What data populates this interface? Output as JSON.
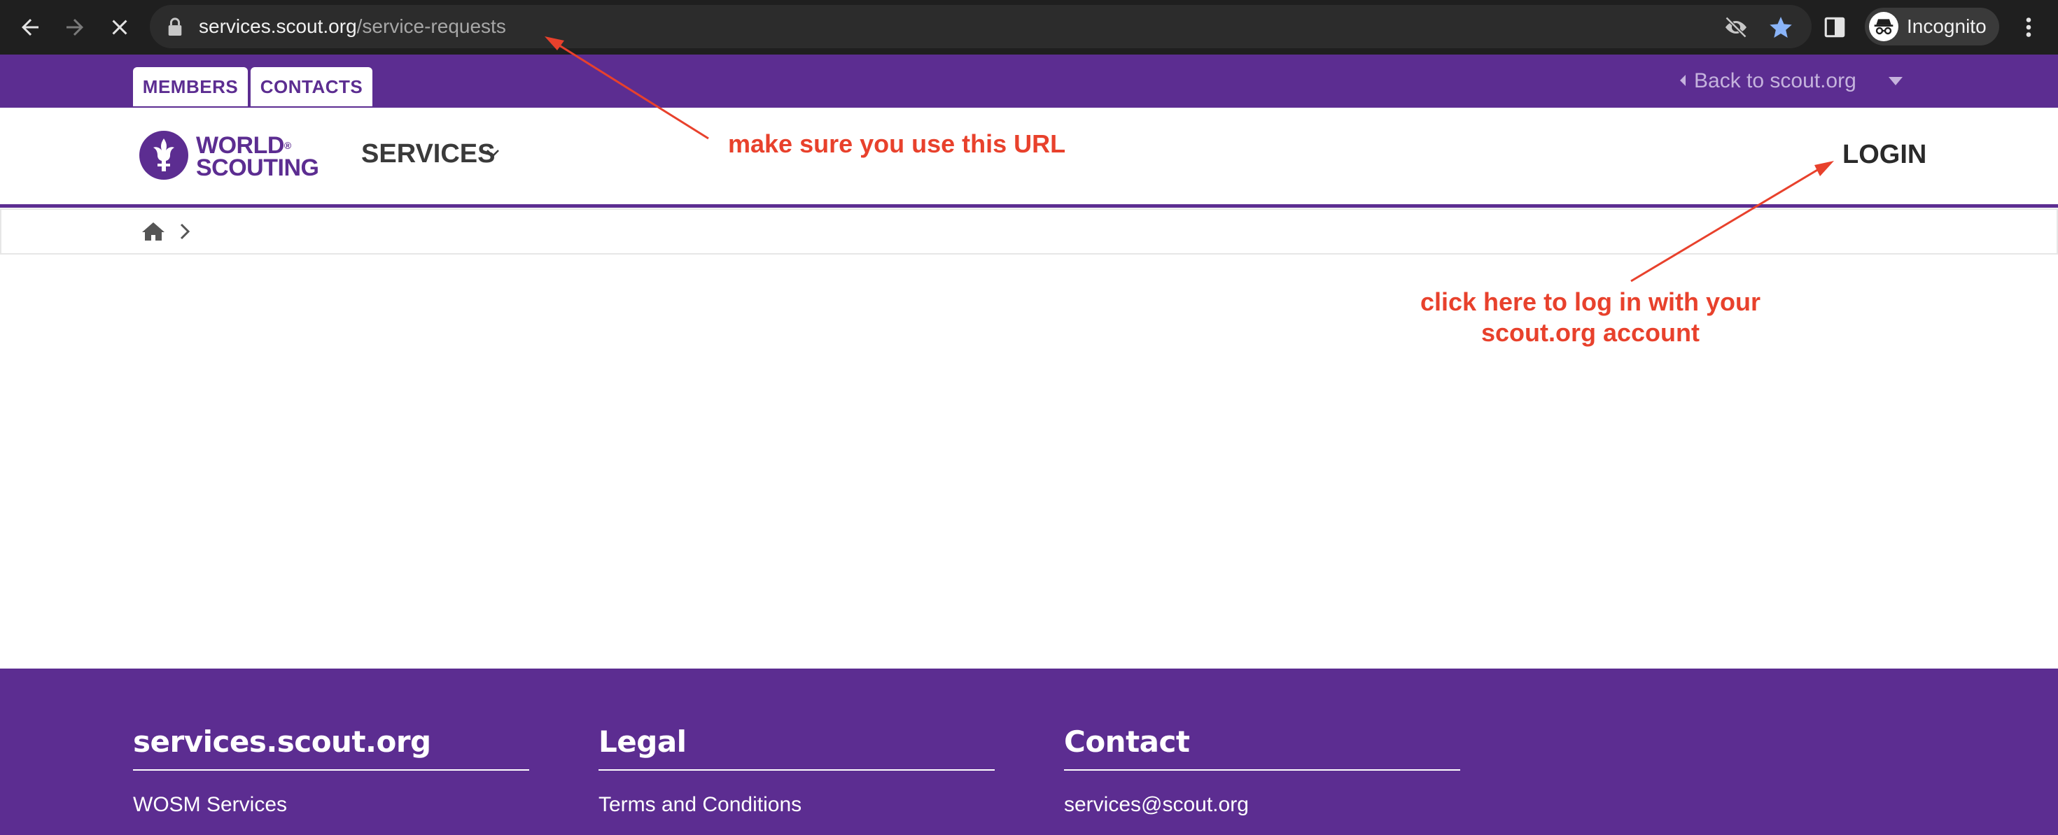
{
  "browser": {
    "url_host": "services.scout.org",
    "url_path": "/service-requests",
    "profile_label": "Incognito",
    "icons": [
      "back-arrow-icon",
      "forward-arrow-icon",
      "stop-loading-icon",
      "lock-icon",
      "eye-off-icon",
      "bookmark-star-icon",
      "side-panel-icon",
      "incognito-icon",
      "kebab-menu-icon"
    ]
  },
  "topbar": {
    "tabs": [
      "MEMBERS",
      "CONTACTS"
    ],
    "back_link": "Back to scout.org"
  },
  "header": {
    "logo_line1": "WORLD",
    "logo_line2": "SCOUTING",
    "logo_registered": "®",
    "services_menu": "SERVICES",
    "login": "LOGIN"
  },
  "annotations": {
    "url_note": "make sure you use this URL",
    "login_note_line1": "click here to log in with your",
    "login_note_line2": "scout.org account"
  },
  "footer": {
    "columns": [
      {
        "title": "services.scout.org",
        "link": "WOSM Services"
      },
      {
        "title": "Legal",
        "link": "Terms and Conditions"
      },
      {
        "title": "Contact",
        "link": "services@scout.org"
      }
    ]
  },
  "colors": {
    "brand_purple": "#5c2d91",
    "annotation_red": "#e8412c",
    "chrome_dark": "#1f1f1f",
    "bookmark_blue": "#8ab4f8"
  }
}
